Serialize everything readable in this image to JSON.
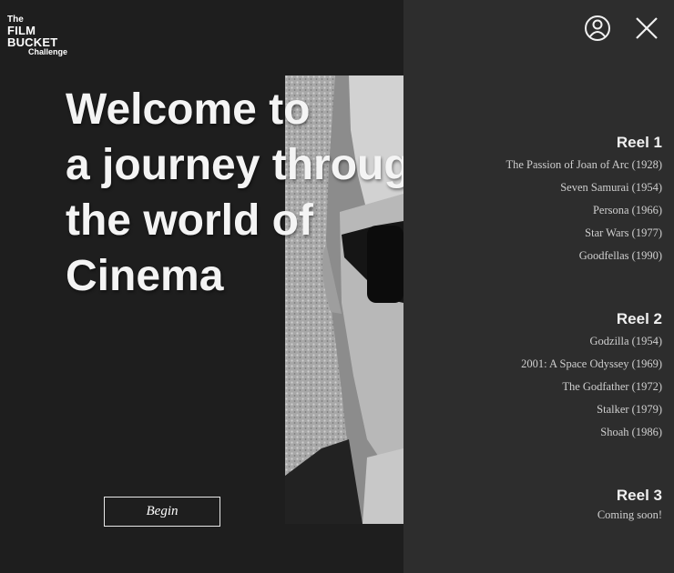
{
  "logo": {
    "line1": "The",
    "line2": "FILM",
    "line3": "BUCKET",
    "line4": "Challenge"
  },
  "headline": {
    "line1": "Welcome to",
    "line2": "a journey through",
    "line3": "the world of",
    "line4": "Cinema"
  },
  "begin_label": "Begin",
  "panel": {
    "reels": [
      {
        "title": "Reel 1",
        "films": [
          "The Passion of Joan of Arc (1928)",
          "Seven Samurai (1954)",
          "Persona (1966)",
          "Star Wars (1977)",
          "Goodfellas (1990)"
        ]
      },
      {
        "title": "Reel 2",
        "films": [
          "Godzilla (1954)",
          "2001: A Space Odyssey (1969)",
          "The Godfather (1972)",
          "Stalker (1979)",
          "Shoah (1986)"
        ]
      },
      {
        "title": "Reel 3",
        "note": "Coming soon!"
      }
    ]
  },
  "icons": {
    "user": "user-circle-icon",
    "close": "close-icon"
  }
}
